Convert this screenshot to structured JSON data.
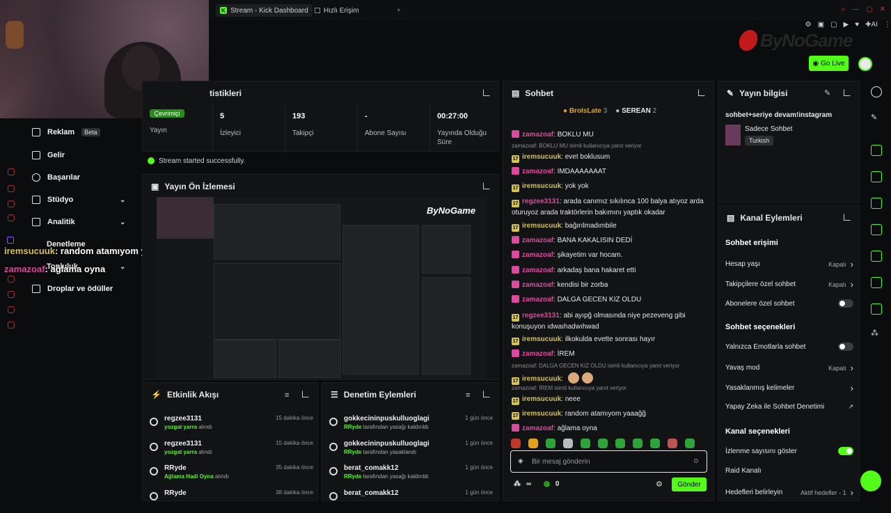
{
  "browser": {
    "tabs": [
      {
        "label": "Stream - Kick Dashboard",
        "active": true
      },
      {
        "label": "Hızlı Erişim",
        "active": false
      }
    ],
    "new_tab": "+",
    "ext_label": "AI"
  },
  "brand": {
    "logo_text": "ByNoGame",
    "accent": "#53fc18"
  },
  "header": {
    "go_live": "Go Live"
  },
  "sidenav": {
    "items": [
      {
        "label": "Reklam",
        "badge": "Beta"
      },
      {
        "label": "Gelir"
      },
      {
        "label": "Başarılar"
      },
      {
        "label": "Stüdyo",
        "expandable": true
      },
      {
        "label": "Analitik",
        "expandable": true
      },
      {
        "label": "Denetleme"
      },
      {
        "label": "Topluluk",
        "expandable": true
      },
      {
        "label": "Droplar ve ödüller"
      }
    ]
  },
  "overlay_chat": [
    {
      "user": "iremsucuuk",
      "msg": ": random atamıyom yaaağğ"
    },
    {
      "user": "zamazoaf",
      "msg": ": ağlama oyna"
    }
  ],
  "stats": {
    "title_fragment": "tistikleri",
    "status_badge": "Çevrimiçi",
    "cells": [
      {
        "value": "",
        "label": "Yayın"
      },
      {
        "value": "5",
        "label": "İzleyici"
      },
      {
        "value": "193",
        "label": "Takipçi"
      },
      {
        "value": "-",
        "label": "Abone Sayısı"
      },
      {
        "value": "00:27:00",
        "label": "Yayında Olduğu Süre"
      }
    ]
  },
  "success_msg": "Stream started successfully.",
  "preview": {
    "title": "Yayın Ön İzlemesi"
  },
  "activity": {
    "title": "Etkinlik Akışı",
    "items": [
      {
        "name": "regzee3131",
        "sub": "yozgat yarra",
        "tail": "alındı",
        "time": "15 dakika önce"
      },
      {
        "name": "regzee3131",
        "sub": "yozgat yarra",
        "tail": "alındı",
        "time": "15 dakika önce"
      },
      {
        "name": "RRyde",
        "sub": "Ağlama Hadi Oyna",
        "tail": "alındı",
        "time": "35 dakika önce"
      },
      {
        "name": "RRyde",
        "sub": "",
        "tail": "",
        "time": "38 dakika önce"
      }
    ]
  },
  "moderation": {
    "title": "Denetim Eylemleri",
    "items": [
      {
        "name": "gokkecininpuskulluoglagi",
        "sub": "RRyde",
        "tail": "tarafından yasağı kaldırıldı",
        "time": "1 gün önce"
      },
      {
        "name": "gokkecininpuskulluoglagi",
        "sub": "RRyde",
        "tail": "tarafından yasaklandı",
        "time": "1 gün önce"
      },
      {
        "name": "berat_comakk12",
        "sub": "RRyde",
        "tail": "tarafından yasağı kaldırıldı",
        "time": "1 gün önce"
      },
      {
        "name": "berat_comakk12",
        "sub": "",
        "tail": "",
        "time": "1 gün önce"
      }
    ]
  },
  "chat": {
    "title": "Sohbet",
    "leaders": [
      {
        "name": "BroIsLate",
        "count": "3"
      },
      {
        "name": "SEREAN",
        "count": "2"
      }
    ],
    "messages": [
      {
        "user": "zamazoaf",
        "color": "#e0479e",
        "badge": "#e0479e",
        "badge_text": "",
        "text": "BOKLU MU",
        "reply": ""
      },
      {
        "user": "iremsucuuk",
        "color": "#d7c34a",
        "badge": "#d7c34a",
        "badge_text": "17",
        "text": "evet boklusum",
        "reply": "zamazoaf: BOKLU MU isimli kullanıcıya yanıt veriyor"
      },
      {
        "user": "zamazoaf",
        "color": "#e0479e",
        "badge": "#e0479e",
        "badge_text": "",
        "text": "IMDAAAAAAAT",
        "reply": ""
      },
      {
        "user": "iremsucuuk",
        "color": "#d7c34a",
        "badge": "#d7c34a",
        "badge_text": "17",
        "text": "yok yok",
        "reply": ""
      },
      {
        "user": "regzee3131",
        "color": "#e0479e",
        "badge": "#d7c34a",
        "badge_text": "17",
        "text": "arada canımız sıkılınca 100 balya atıyoz arda oturuyoz arada traktörlerin bakımını yaptık okadar",
        "reply": ""
      },
      {
        "user": "iremsucuuk",
        "color": "#d7c34a",
        "badge": "#d7c34a",
        "badge_text": "17",
        "text": "bağırılmadımbile",
        "reply": ""
      },
      {
        "user": "zamazoaf",
        "color": "#e0479e",
        "badge": "#e0479e",
        "badge_text": "",
        "text": "BANA KAKALISIN DEDİ",
        "reply": ""
      },
      {
        "user": "zamazoaf",
        "color": "#e0479e",
        "badge": "#e0479e",
        "badge_text": "",
        "text": "şikayetim var hocam.",
        "reply": ""
      },
      {
        "user": "zamazoaf",
        "color": "#e0479e",
        "badge": "#e0479e",
        "badge_text": "",
        "text": "arkadaş bana hakaret etti",
        "reply": ""
      },
      {
        "user": "zamazoaf",
        "color": "#e0479e",
        "badge": "#e0479e",
        "badge_text": "",
        "text": "kendisi bir zorba",
        "reply": ""
      },
      {
        "user": "zamazoaf",
        "color": "#e0479e",
        "badge": "#e0479e",
        "badge_text": "",
        "text": "DALGA GECEN KIZ OLDU",
        "reply": ""
      },
      {
        "user": "regzee3131",
        "color": "#e0479e",
        "badge": "#d7c34a",
        "badge_text": "17",
        "text": "abi ayıpğ olmasında niye pezeveng gibi konuşuyon ıdwaıhadwıhwad",
        "reply": ""
      },
      {
        "user": "iremsucuuk",
        "color": "#d7c34a",
        "badge": "#d7c34a",
        "badge_text": "17",
        "text": "ilkokulda evette sonrası hayır",
        "reply": ""
      },
      {
        "user": "zamazoaf",
        "color": "#e0479e",
        "badge": "#e0479e",
        "badge_text": "",
        "text": "İREM",
        "reply": ""
      },
      {
        "user": "iremsucuuk",
        "color": "#d7c34a",
        "badge": "#d7c34a",
        "badge_text": "17",
        "text": "",
        "reply": "zamazoaf: DALGA GECEN KIZ OLDU isimli kullanıcıya yanıt veriyor"
      },
      {
        "user": "iremsucuuk",
        "color": "#d7c34a",
        "badge": "#d7c34a",
        "badge_text": "17",
        "text": "neee",
        "reply": "zamazoaf: İREM isimli kullanıcıya yanıt veriyor"
      },
      {
        "user": "iremsucuuk",
        "color": "#d7c34a",
        "badge": "#d7c34a",
        "badge_text": "17",
        "text": "random atamıyom yaaağğ",
        "reply": ""
      },
      {
        "user": "zamazoaf",
        "color": "#e0479e",
        "badge": "#e0479e",
        "badge_text": "",
        "text": "ağlama oyna",
        "reply": ""
      }
    ],
    "input_placeholder": "Bir mesaj gönderin",
    "points": "0",
    "send_label": "Gönder"
  },
  "stream_info": {
    "title": "Yayın bilgisi",
    "stream_title": "sohbet+seriye devam!instagram",
    "category": "Sadece Sohbet",
    "language": "Turkish"
  },
  "channel_actions": {
    "title": "Kanal Eylemleri",
    "chat_access_title": "Sohbet erişimi",
    "chat_access": [
      {
        "label": "Hesap yaşı",
        "value": "Kapalı",
        "control": "chevron"
      },
      {
        "label": "Takipçilere özel sohbet",
        "value": "Kapalı",
        "control": "chevron"
      },
      {
        "label": "Abonelere özel sohbet",
        "value": "",
        "control": "toggle-off"
      }
    ],
    "chat_options_title": "Sohbet seçenekleri",
    "chat_options": [
      {
        "label": "Yalnızca Emotlarla sohbet",
        "value": "",
        "control": "toggle-off"
      },
      {
        "label": "Yavaş mod",
        "value": "Kapalı",
        "control": "chevron"
      },
      {
        "label": "Yasaklanmış kelimeler",
        "value": "",
        "control": "chevron"
      },
      {
        "label": "Yapay Zeka ile Sohbet Denetimi",
        "value": "",
        "control": "external"
      }
    ],
    "channel_options_title": "Kanal seçenekleri",
    "channel_options": [
      {
        "label": "İzlenme sayısını göster",
        "value": "",
        "control": "toggle-on"
      },
      {
        "label": "Raid Kanalı",
        "value": "",
        "control": "none"
      },
      {
        "label": "Hedefleri belirleyin",
        "value": "Aktif hedefler - 1",
        "control": "chevron"
      }
    ]
  }
}
